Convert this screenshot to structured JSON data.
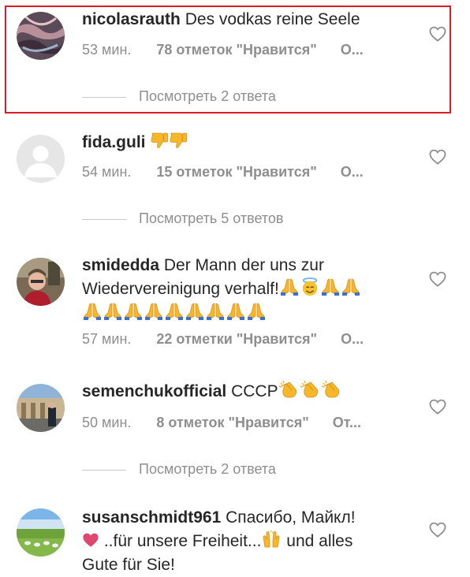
{
  "comments": [
    {
      "username": "nicolasrauth",
      "text": "Des vodkas reine Seele",
      "time": "53 мин.",
      "likes": "78 отметок \"Нравится\"",
      "reply": "О...",
      "view_replies": "Посмотреть 2 ответа"
    },
    {
      "username": "fida.guli",
      "text": "",
      "emoji": [
        "thumbs-down-icon",
        "thumbs-down-icon"
      ],
      "time": "54 мин.",
      "likes": "15 отметок \"Нравится\"",
      "reply": "О...",
      "view_replies": "Посмотреть 5 ответов"
    },
    {
      "username": "smidedda",
      "text_line1": "Der Mann der",
      "text_line1b": "uns zur",
      "text_line2": "Wiedervereinigung verhalf!",
      "emoji": [
        "pray-icon",
        "halo-face-icon",
        "pray-icon",
        "pray-icon",
        "pray-icon",
        "pray-icon",
        "pray-icon",
        "pray-icon",
        "pray-icon",
        "pray-icon",
        "pray-icon",
        "pray-icon",
        "pray-icon"
      ],
      "time": "57 мин.",
      "likes": "22 отметки \"Нравится\"",
      "reply": "О..."
    },
    {
      "username": "semenchukofficial",
      "text": "СССР",
      "emoji": [
        "clap-icon",
        "clap-icon",
        "clap-icon"
      ],
      "time": "50 мин.",
      "likes": "8 отметок \"Нравится\"",
      "reply": "От...",
      "view_replies": "Посмотреть 2 ответа"
    },
    {
      "username": "susanschmidt961",
      "text_line1": "Спасибо, Майкл!",
      "text_line2a": "..für unsere Freiheit...",
      "text_line2b": "und alles",
      "text_line3": "Gute für Sie!",
      "emoji": [
        "heart-icon",
        "raised-hands-icon"
      ]
    }
  ],
  "colors": {
    "text": "#262626",
    "meta": "#8e8e8e",
    "highlight_border": "#d61f2a"
  }
}
